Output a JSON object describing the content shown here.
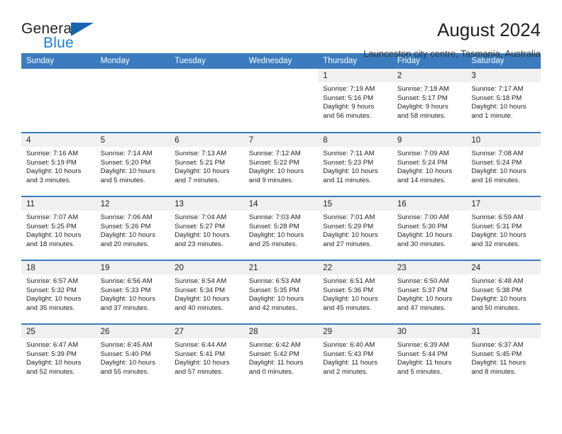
{
  "brand": {
    "name_top": "General",
    "name_bottom": "Blue",
    "triangle_color": "#1565b0",
    "blue_color": "#1b7fd4"
  },
  "header": {
    "title": "August 2024",
    "subtitle": "Launceston city centre, Tasmania, Australia"
  },
  "theme": {
    "header_bg": "#3a7cbf",
    "date_strip_bg": "#f0f0f0",
    "text": "#222222"
  },
  "weekday_headers": [
    "Sunday",
    "Monday",
    "Tuesday",
    "Wednesday",
    "Thursday",
    "Friday",
    "Saturday"
  ],
  "weeks": [
    [
      {
        "day": ""
      },
      {
        "day": ""
      },
      {
        "day": ""
      },
      {
        "day": ""
      },
      {
        "day": "1",
        "sunrise": "Sunrise: 7:19 AM",
        "sunset": "Sunset: 5:16 PM",
        "daylight_line1": "Daylight: 9 hours",
        "daylight_line2": "and 56 minutes."
      },
      {
        "day": "2",
        "sunrise": "Sunrise: 7:18 AM",
        "sunset": "Sunset: 5:17 PM",
        "daylight_line1": "Daylight: 9 hours",
        "daylight_line2": "and 58 minutes."
      },
      {
        "day": "3",
        "sunrise": "Sunrise: 7:17 AM",
        "sunset": "Sunset: 5:18 PM",
        "daylight_line1": "Daylight: 10 hours",
        "daylight_line2": "and 1 minute."
      }
    ],
    [
      {
        "day": "4",
        "sunrise": "Sunrise: 7:16 AM",
        "sunset": "Sunset: 5:19 PM",
        "daylight_line1": "Daylight: 10 hours",
        "daylight_line2": "and 3 minutes."
      },
      {
        "day": "5",
        "sunrise": "Sunrise: 7:14 AM",
        "sunset": "Sunset: 5:20 PM",
        "daylight_line1": "Daylight: 10 hours",
        "daylight_line2": "and 5 minutes."
      },
      {
        "day": "6",
        "sunrise": "Sunrise: 7:13 AM",
        "sunset": "Sunset: 5:21 PM",
        "daylight_line1": "Daylight: 10 hours",
        "daylight_line2": "and 7 minutes."
      },
      {
        "day": "7",
        "sunrise": "Sunrise: 7:12 AM",
        "sunset": "Sunset: 5:22 PM",
        "daylight_line1": "Daylight: 10 hours",
        "daylight_line2": "and 9 minutes."
      },
      {
        "day": "8",
        "sunrise": "Sunrise: 7:11 AM",
        "sunset": "Sunset: 5:23 PM",
        "daylight_line1": "Daylight: 10 hours",
        "daylight_line2": "and 11 minutes."
      },
      {
        "day": "9",
        "sunrise": "Sunrise: 7:09 AM",
        "sunset": "Sunset: 5:24 PM",
        "daylight_line1": "Daylight: 10 hours",
        "daylight_line2": "and 14 minutes."
      },
      {
        "day": "10",
        "sunrise": "Sunrise: 7:08 AM",
        "sunset": "Sunset: 5:24 PM",
        "daylight_line1": "Daylight: 10 hours",
        "daylight_line2": "and 16 minutes."
      }
    ],
    [
      {
        "day": "11",
        "sunrise": "Sunrise: 7:07 AM",
        "sunset": "Sunset: 5:25 PM",
        "daylight_line1": "Daylight: 10 hours",
        "daylight_line2": "and 18 minutes."
      },
      {
        "day": "12",
        "sunrise": "Sunrise: 7:06 AM",
        "sunset": "Sunset: 5:26 PM",
        "daylight_line1": "Daylight: 10 hours",
        "daylight_line2": "and 20 minutes."
      },
      {
        "day": "13",
        "sunrise": "Sunrise: 7:04 AM",
        "sunset": "Sunset: 5:27 PM",
        "daylight_line1": "Daylight: 10 hours",
        "daylight_line2": "and 23 minutes."
      },
      {
        "day": "14",
        "sunrise": "Sunrise: 7:03 AM",
        "sunset": "Sunset: 5:28 PM",
        "daylight_line1": "Daylight: 10 hours",
        "daylight_line2": "and 25 minutes."
      },
      {
        "day": "15",
        "sunrise": "Sunrise: 7:01 AM",
        "sunset": "Sunset: 5:29 PM",
        "daylight_line1": "Daylight: 10 hours",
        "daylight_line2": "and 27 minutes."
      },
      {
        "day": "16",
        "sunrise": "Sunrise: 7:00 AM",
        "sunset": "Sunset: 5:30 PM",
        "daylight_line1": "Daylight: 10 hours",
        "daylight_line2": "and 30 minutes."
      },
      {
        "day": "17",
        "sunrise": "Sunrise: 6:59 AM",
        "sunset": "Sunset: 5:31 PM",
        "daylight_line1": "Daylight: 10 hours",
        "daylight_line2": "and 32 minutes."
      }
    ],
    [
      {
        "day": "18",
        "sunrise": "Sunrise: 6:57 AM",
        "sunset": "Sunset: 5:32 PM",
        "daylight_line1": "Daylight: 10 hours",
        "daylight_line2": "and 35 minutes."
      },
      {
        "day": "19",
        "sunrise": "Sunrise: 6:56 AM",
        "sunset": "Sunset: 5:33 PM",
        "daylight_line1": "Daylight: 10 hours",
        "daylight_line2": "and 37 minutes."
      },
      {
        "day": "20",
        "sunrise": "Sunrise: 6:54 AM",
        "sunset": "Sunset: 5:34 PM",
        "daylight_line1": "Daylight: 10 hours",
        "daylight_line2": "and 40 minutes."
      },
      {
        "day": "21",
        "sunrise": "Sunrise: 6:53 AM",
        "sunset": "Sunset: 5:35 PM",
        "daylight_line1": "Daylight: 10 hours",
        "daylight_line2": "and 42 minutes."
      },
      {
        "day": "22",
        "sunrise": "Sunrise: 6:51 AM",
        "sunset": "Sunset: 5:36 PM",
        "daylight_line1": "Daylight: 10 hours",
        "daylight_line2": "and 45 minutes."
      },
      {
        "day": "23",
        "sunrise": "Sunrise: 6:50 AM",
        "sunset": "Sunset: 5:37 PM",
        "daylight_line1": "Daylight: 10 hours",
        "daylight_line2": "and 47 minutes."
      },
      {
        "day": "24",
        "sunrise": "Sunrise: 6:48 AM",
        "sunset": "Sunset: 5:38 PM",
        "daylight_line1": "Daylight: 10 hours",
        "daylight_line2": "and 50 minutes."
      }
    ],
    [
      {
        "day": "25",
        "sunrise": "Sunrise: 6:47 AM",
        "sunset": "Sunset: 5:39 PM",
        "daylight_line1": "Daylight: 10 hours",
        "daylight_line2": "and 52 minutes."
      },
      {
        "day": "26",
        "sunrise": "Sunrise: 6:45 AM",
        "sunset": "Sunset: 5:40 PM",
        "daylight_line1": "Daylight: 10 hours",
        "daylight_line2": "and 55 minutes."
      },
      {
        "day": "27",
        "sunrise": "Sunrise: 6:44 AM",
        "sunset": "Sunset: 5:41 PM",
        "daylight_line1": "Daylight: 10 hours",
        "daylight_line2": "and 57 minutes."
      },
      {
        "day": "28",
        "sunrise": "Sunrise: 6:42 AM",
        "sunset": "Sunset: 5:42 PM",
        "daylight_line1": "Daylight: 11 hours",
        "daylight_line2": "and 0 minutes."
      },
      {
        "day": "29",
        "sunrise": "Sunrise: 6:40 AM",
        "sunset": "Sunset: 5:43 PM",
        "daylight_line1": "Daylight: 11 hours",
        "daylight_line2": "and 2 minutes."
      },
      {
        "day": "30",
        "sunrise": "Sunrise: 6:39 AM",
        "sunset": "Sunset: 5:44 PM",
        "daylight_line1": "Daylight: 11 hours",
        "daylight_line2": "and 5 minutes."
      },
      {
        "day": "31",
        "sunrise": "Sunrise: 6:37 AM",
        "sunset": "Sunset: 5:45 PM",
        "daylight_line1": "Daylight: 11 hours",
        "daylight_line2": "and 8 minutes."
      }
    ]
  ]
}
